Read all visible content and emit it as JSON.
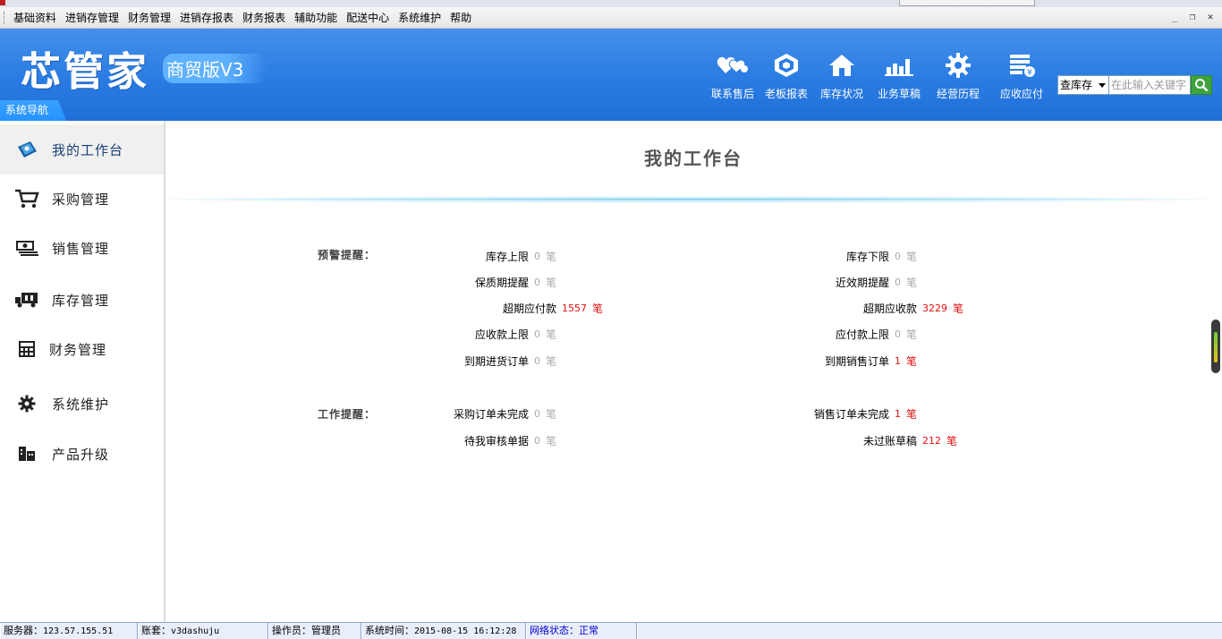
{
  "menubar": {
    "items": [
      "基础资料",
      "进销存管理",
      "财务管理",
      "进销存报表",
      "财务报表",
      "辅助功能",
      "配送中心",
      "系统维护",
      "帮助"
    ],
    "window_controls": [
      "_",
      "❐",
      "✕"
    ]
  },
  "header": {
    "logo_main": "芯管家",
    "logo_sub": "商贸版V3",
    "nav_label": "系统导航",
    "tools": [
      {
        "label": "联系售后",
        "icon": "heart-chat-icon"
      },
      {
        "label": "老板报表",
        "icon": "report-hexagon-icon"
      },
      {
        "label": "库存状况",
        "icon": "house-icon"
      },
      {
        "label": "业务草稿",
        "icon": "bar-chart-icon"
      },
      {
        "label": "经营历程",
        "icon": "gear-icon"
      },
      {
        "label": "应收应付",
        "icon": "money-list-icon"
      }
    ],
    "search": {
      "selected": "查库存",
      "placeholder": "在此输入关键字"
    }
  },
  "sidebar": {
    "items": [
      {
        "label": "我的工作台",
        "icon": "workbench-icon",
        "active": true
      },
      {
        "label": "采购管理",
        "icon": "cart-icon"
      },
      {
        "label": "销售管理",
        "icon": "cash-icon"
      },
      {
        "label": "库存管理",
        "icon": "truck-icon"
      },
      {
        "label": "财务管理",
        "icon": "calculator-icon"
      },
      {
        "label": "系统维护",
        "icon": "gear-icon"
      },
      {
        "label": "产品升级",
        "icon": "upgrade-icon"
      }
    ]
  },
  "main": {
    "title": "我的工作台",
    "warning": {
      "label": "预警提醒：",
      "left": [
        {
          "label": "库存上限",
          "value": "0",
          "unit": "笔"
        },
        {
          "label": "保质期提醒",
          "value": "0",
          "unit": "笔"
        },
        {
          "label": "超期应付款",
          "value": "1557",
          "unit": "笔"
        },
        {
          "label": "应收款上限",
          "value": "0",
          "unit": "笔"
        },
        {
          "label": "到期进货订单",
          "value": "0",
          "unit": "笔"
        }
      ],
      "right": [
        {
          "label": "库存下限",
          "value": "0",
          "unit": "笔"
        },
        {
          "label": "近效期提醒",
          "value": "0",
          "unit": "笔"
        },
        {
          "label": "超期应收款",
          "value": "3229",
          "unit": "笔"
        },
        {
          "label": "应付款上限",
          "value": "0",
          "unit": "笔"
        },
        {
          "label": "到期销售订单",
          "value": "1",
          "unit": "笔"
        }
      ]
    },
    "work": {
      "label": "工作提醒：",
      "left": [
        {
          "label": "采购订单未完成",
          "value": "0",
          "unit": "笔"
        },
        {
          "label": "待我审核单据",
          "value": "0",
          "unit": "笔"
        }
      ],
      "right": [
        {
          "label": "销售订单未完成",
          "value": "1",
          "unit": "笔"
        },
        {
          "label": "未过账草稿",
          "value": "212",
          "unit": "笔"
        }
      ]
    }
  },
  "status": {
    "server_label": "服务器：",
    "server": "123.57.155.51",
    "account_label": "账套：",
    "account": "v3dashuju",
    "operator_label": "操作员：",
    "operator": "管理员",
    "time_label": "系统时间：",
    "time": "2015-08-15 16:12:28",
    "net_label": "网络状态：",
    "net": "正常"
  }
}
